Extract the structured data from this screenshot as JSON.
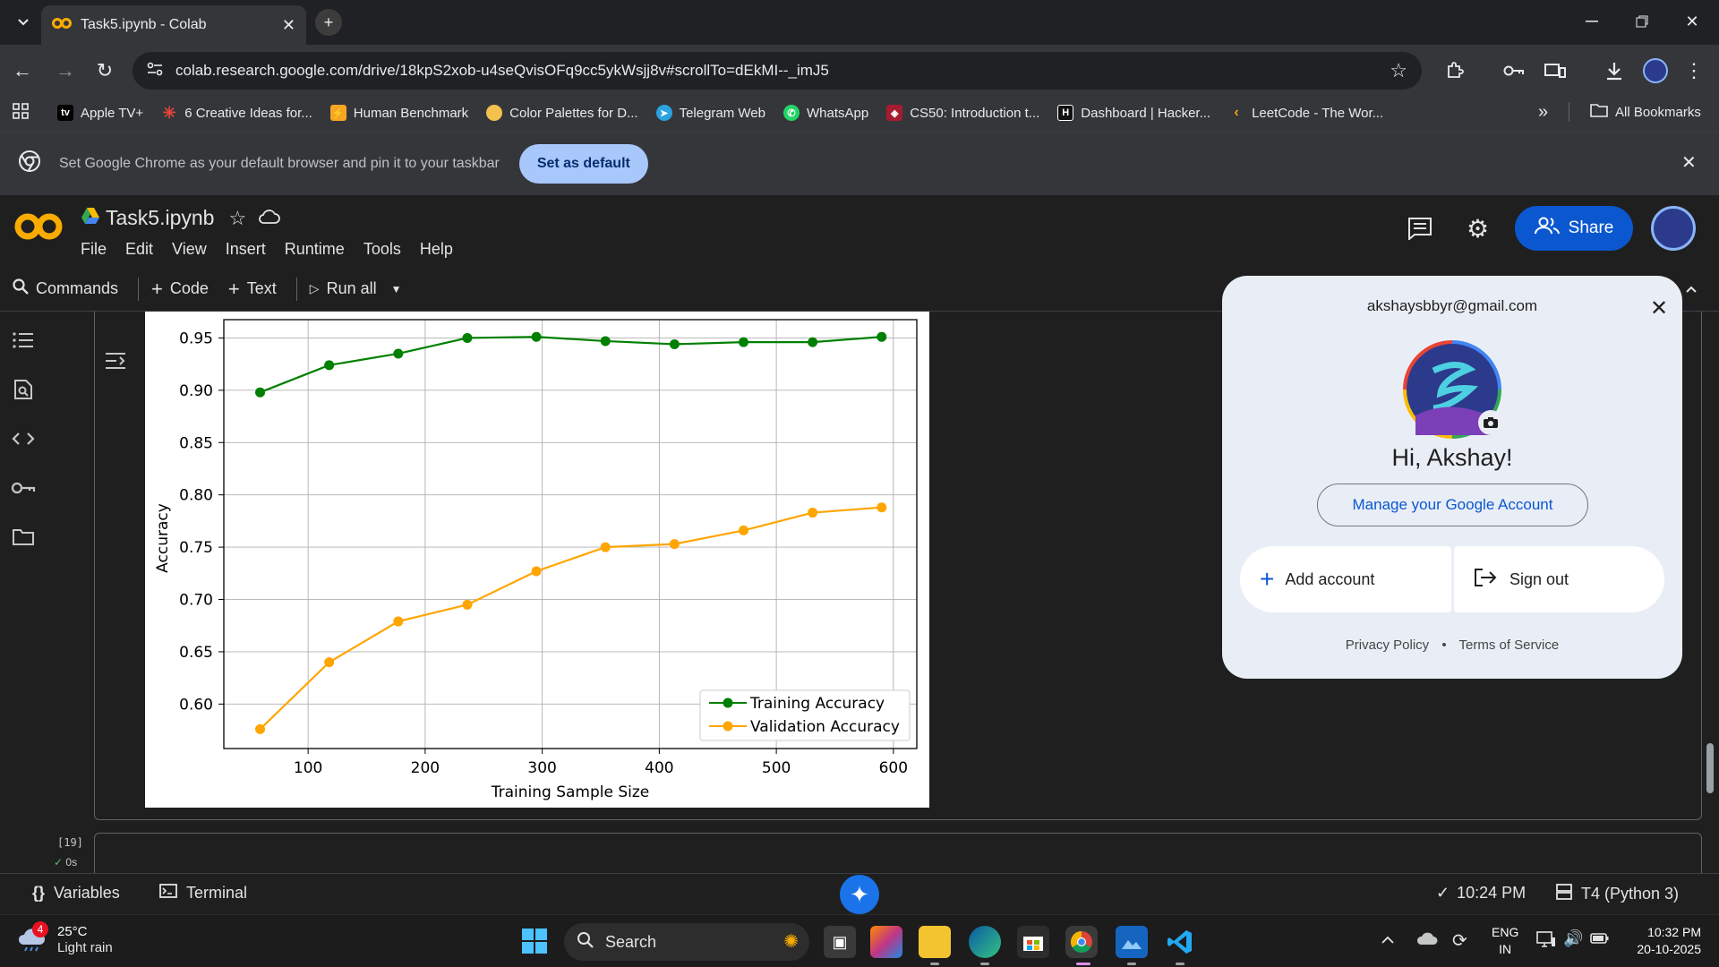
{
  "browser": {
    "tab_title": "Task5.ipynb - Colab",
    "url": "colab.research.google.com/drive/18kpS2xob-u4seQvisOFq9cc5ykWsjj8v#scrollTo=dEkMI--_imJ5",
    "bookmarks": [
      {
        "label": "Apple TV+",
        "icon": "apple-tv-icon",
        "color": "#000000"
      },
      {
        "label": "6 Creative Ideas for...",
        "icon": "asterisk-icon",
        "color": "#e8453c"
      },
      {
        "label": "Human Benchmark",
        "icon": "bolt-icon",
        "color": "#f5a623"
      },
      {
        "label": "Color Palettes for D...",
        "icon": "palette-icon",
        "color": "#f2c14e"
      },
      {
        "label": "Telegram Web",
        "icon": "telegram-icon",
        "color": "#2aa3e0"
      },
      {
        "label": "WhatsApp",
        "icon": "whatsapp-icon",
        "color": "#25d366"
      },
      {
        "label": "CS50: Introduction t...",
        "icon": "cs50-icon",
        "color": "#a51c30"
      },
      {
        "label": "Dashboard | Hacker...",
        "icon": "hackerrank-icon",
        "color": "#111111"
      },
      {
        "label": "LeetCode - The Wor...",
        "icon": "leetcode-icon",
        "color": "#ffa116"
      }
    ],
    "all_bookmarks": "All Bookmarks",
    "infobar_message": "Set Google Chrome as your default browser and pin it to your taskbar",
    "set_default": "Set as default"
  },
  "colab": {
    "notebook_name": "Task5.ipynb",
    "menus": [
      "File",
      "Edit",
      "View",
      "Insert",
      "Runtime",
      "Tools",
      "Help"
    ],
    "share": "Share",
    "commands": "Commands",
    "add_code": "Code",
    "add_text": "Text",
    "run_all": "Run all",
    "next_cell_number": "[19]",
    "next_cell_time": "0s",
    "variables": "Variables",
    "terminal": "Terminal",
    "last_run": "10:24 PM",
    "runtime": "T4 (Python 3)"
  },
  "account": {
    "email": "akshaysbbyr@gmail.com",
    "greeting": "Hi, Akshay!",
    "manage": "Manage your Google Account",
    "add_account": "Add account",
    "sign_out": "Sign out",
    "privacy": "Privacy Policy",
    "terms": "Terms of Service"
  },
  "taskbar": {
    "weather_temp": "25°C",
    "weather_desc": "Light rain",
    "weather_badge": "4",
    "search": "Search",
    "lang1": "ENG",
    "lang2": "IN",
    "time": "10:32 PM",
    "date": "20-10-2025"
  },
  "chart_data": {
    "type": "line",
    "xlabel": "Training Sample Size",
    "ylabel": "Accuracy",
    "xlim": [
      28,
      620
    ],
    "ylim": [
      0.5575,
      0.9675
    ],
    "xticks": [
      100,
      200,
      300,
      400,
      500,
      600
    ],
    "yticks": [
      0.6,
      0.65,
      0.7,
      0.75,
      0.8,
      0.85,
      0.9,
      0.95
    ],
    "grid": true,
    "legend": "lower-right",
    "x": [
      59,
      118,
      177,
      236,
      295,
      354,
      413,
      472,
      531,
      590
    ],
    "series": [
      {
        "name": "Training Accuracy",
        "color": "#008000",
        "values": [
          0.898,
          0.924,
          0.935,
          0.95,
          0.951,
          0.947,
          0.944,
          0.946,
          0.946,
          0.951
        ]
      },
      {
        "name": "Validation Accuracy",
        "color": "#ffa500",
        "values": [
          0.576,
          0.64,
          0.679,
          0.695,
          0.727,
          0.75,
          0.753,
          0.766,
          0.783,
          0.788
        ]
      }
    ]
  }
}
